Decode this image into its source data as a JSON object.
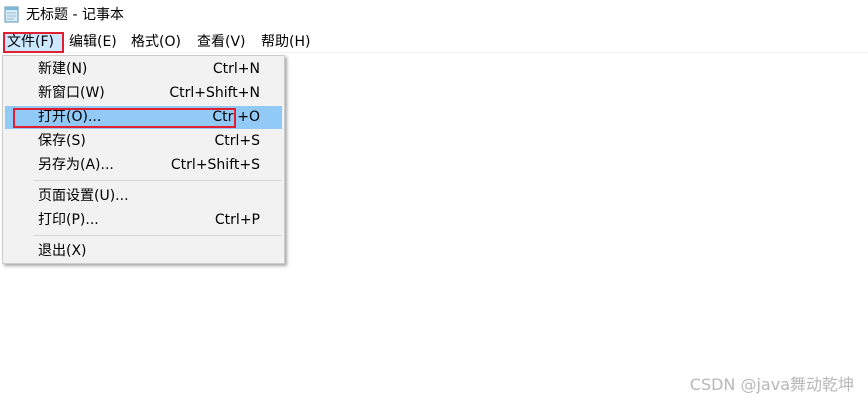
{
  "window": {
    "title": "无标题 - 记事本",
    "icon": "notepad-icon"
  },
  "menubar": {
    "items": [
      {
        "label": "文件(F)",
        "active": true
      },
      {
        "label": "编辑(E)"
      },
      {
        "label": "格式(O)"
      },
      {
        "label": "查看(V)"
      },
      {
        "label": "帮助(H)"
      }
    ]
  },
  "file_menu": {
    "items": [
      {
        "label": "新建(N)",
        "shortcut": "Ctrl+N"
      },
      {
        "label": "新窗口(W)",
        "shortcut": "Ctrl+Shift+N"
      },
      {
        "label": "打开(O)...",
        "shortcut": "Ctrl+O",
        "highlighted": true
      },
      {
        "label": "保存(S)",
        "shortcut": "Ctrl+S"
      },
      {
        "label": "另存为(A)...",
        "shortcut": "Ctrl+Shift+S"
      },
      {
        "label": "页面设置(U)...",
        "shortcut": ""
      },
      {
        "label": "打印(P)...",
        "shortcut": "Ctrl+P"
      },
      {
        "label": "退出(X)",
        "shortcut": ""
      }
    ]
  },
  "colors": {
    "highlight": "#91c9f7",
    "annotation_red": "#e02030",
    "menu_bg": "#f2f2f2"
  },
  "watermark": "CSDN @java舞动乾坤"
}
